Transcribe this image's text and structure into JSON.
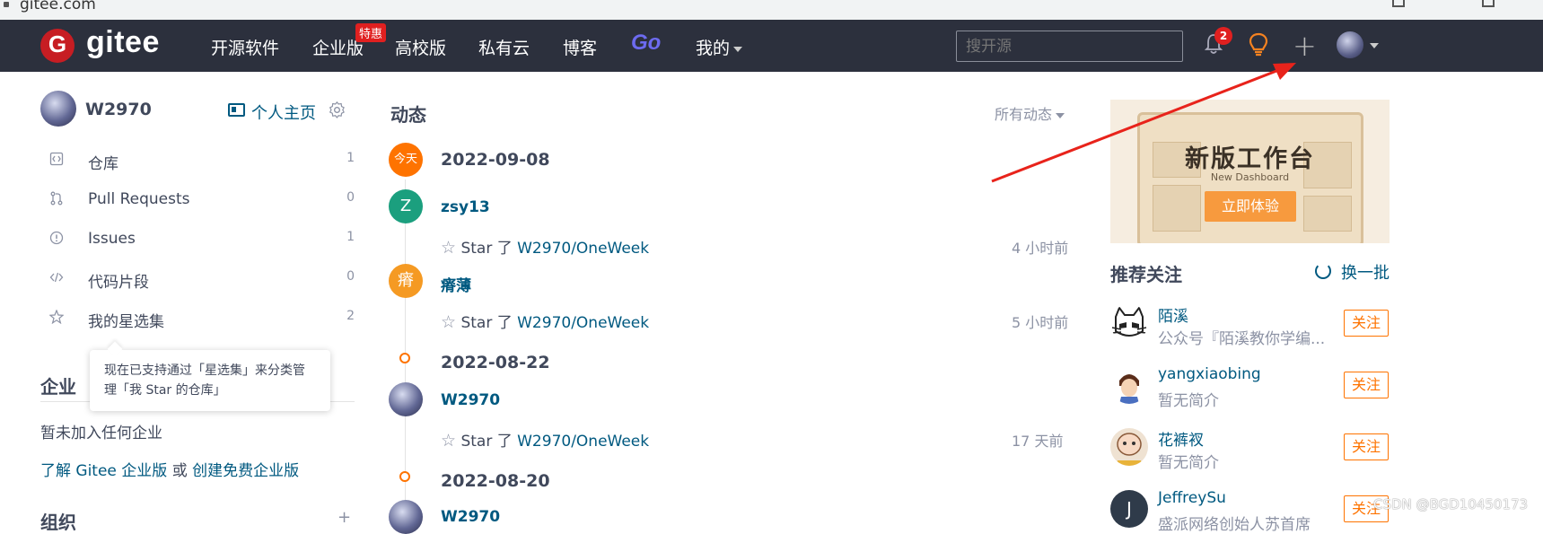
{
  "browser": {
    "url": "gitee.com"
  },
  "nav": {
    "logo_letter": "G",
    "logo_text": "gitee",
    "links": [
      "开源软件",
      "企业版",
      "高校版",
      "私有云",
      "博客",
      "Go",
      "我的"
    ],
    "hot_badge": "特惠",
    "search_placeholder": "搜开源",
    "notification_count": "2",
    "plus_label": "+"
  },
  "profile": {
    "username": "W2970",
    "home_link": "个人主页",
    "items": [
      {
        "label": "仓库",
        "count": "1"
      },
      {
        "label": "Pull Requests",
        "count": "0"
      },
      {
        "label": "Issues",
        "count": "1"
      },
      {
        "label": "代码片段",
        "count": "0"
      },
      {
        "label": "我的星选集",
        "count": "2"
      }
    ],
    "tooltip": "现在已支持通过「星选集」来分类管理「我 Star 的仓库」"
  },
  "enterprise": {
    "title": "企业",
    "empty": "暂未加入任何企业",
    "learn_link": "了解 Gitee 企业版",
    "or_text": " 或 ",
    "create_link": "创建免费企业版"
  },
  "org": {
    "title": "组织",
    "more": "+"
  },
  "feed": {
    "title": "动态",
    "filter": "所有动态",
    "today_label": "今天",
    "groups": [
      {
        "date": "2022-09-08",
        "events": [
          {
            "avatar_text": "Z",
            "user": "zsy13",
            "verb": "Star 了 ",
            "repo": "W2970/OneWeek",
            "time": "4 小时前"
          },
          {
            "avatar_text": "瘠",
            "user": "瘠薄",
            "verb": "Star 了 ",
            "repo": "W2970/OneWeek",
            "time": "5 小时前"
          }
        ]
      },
      {
        "date": "2022-08-22",
        "events": [
          {
            "avatar_text": "",
            "user": "W2970",
            "verb": "Star 了 ",
            "repo": "W2970/OneWeek",
            "time": "17 天前"
          }
        ]
      },
      {
        "date": "2022-08-20",
        "events": [
          {
            "avatar_text": "",
            "user": "W2970"
          }
        ]
      }
    ]
  },
  "banner": {
    "title": "新版工作台",
    "subtitle": "New Dashboard",
    "button": "立即体验"
  },
  "recommend": {
    "title": "推荐关注",
    "refresh": "换一批",
    "follow_label": "关注",
    "users": [
      {
        "name": "陌溪",
        "desc": "公众号『陌溪教你学编..."
      },
      {
        "name": "yangxiaobing",
        "desc": "暂无简介"
      },
      {
        "name": "花裤衩",
        "desc": "暂无简介"
      },
      {
        "name": "JeffreySu",
        "desc": "盛派网络创始人苏首席"
      }
    ]
  },
  "watermark": "CSDN @BGD10450173",
  "colors": {
    "brand": "#c71d23",
    "nav_bg": "#2c303d",
    "link": "#005980",
    "accent": "#fe7300",
    "arrow": "#e8231b"
  }
}
